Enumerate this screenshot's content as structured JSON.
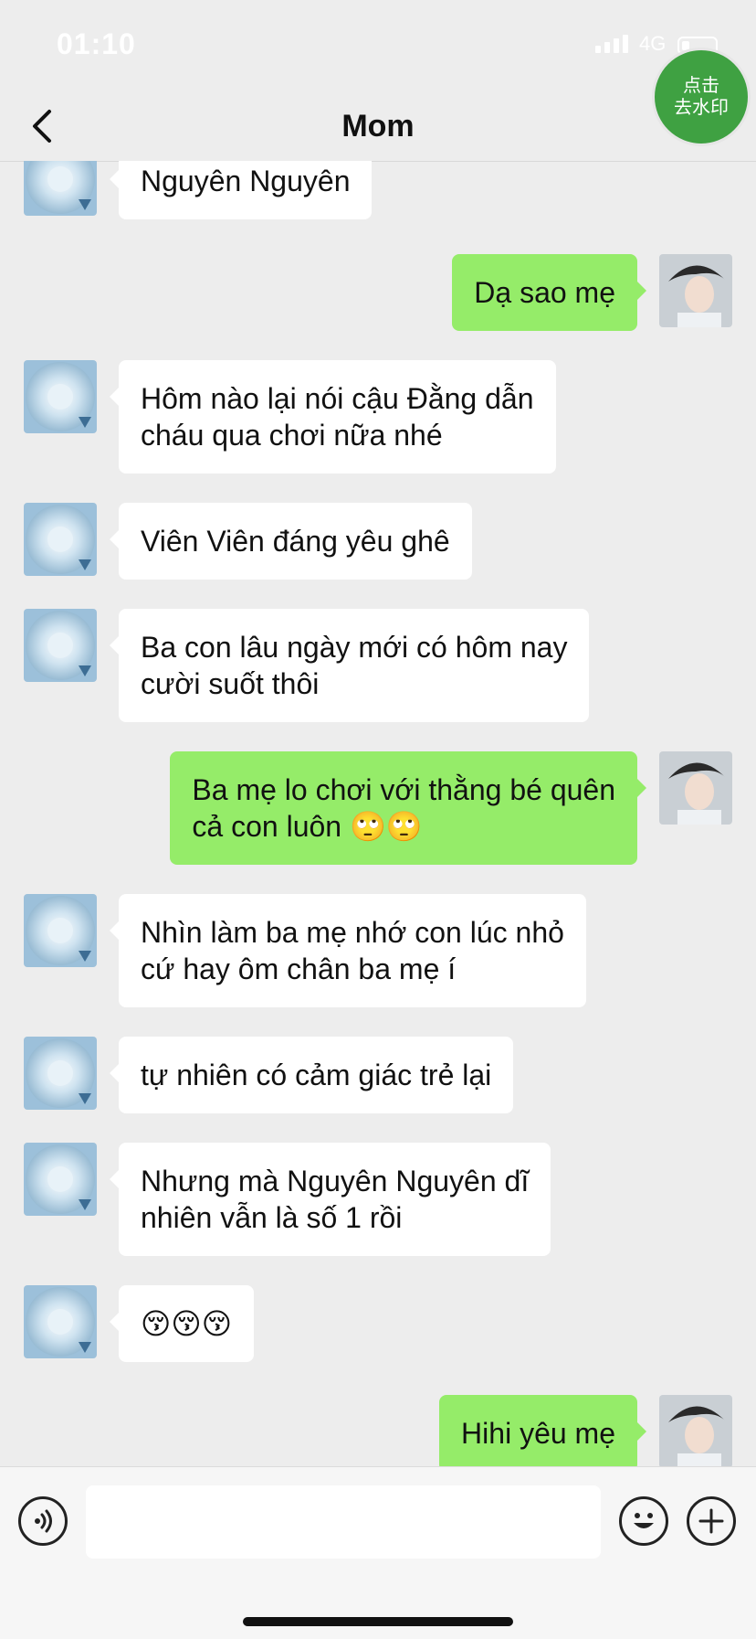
{
  "status_bar": {
    "time": "01:10",
    "network": "4G"
  },
  "header": {
    "title": "Mom"
  },
  "watermark_badge": {
    "line1": "点击",
    "line2": "去水印"
  },
  "messages": [
    {
      "from": "mom",
      "text": "Nguyên Nguyên"
    },
    {
      "from": "me",
      "text": "Dạ sao mẹ"
    },
    {
      "from": "mom",
      "text": "Hôm nào lại nói cậu Đằng dẫn\ncháu qua chơi nữa nhé"
    },
    {
      "from": "mom",
      "text": "Viên Viên đáng yêu ghê"
    },
    {
      "from": "mom",
      "text": "Ba con lâu ngày mới có hôm nay\ncười suốt thôi"
    },
    {
      "from": "me",
      "text": "Ba mẹ lo chơi với thằng bé quên\ncả con luôn 🙄🙄"
    },
    {
      "from": "mom",
      "text": "Nhìn làm ba mẹ nhớ con lúc nhỏ\ncứ hay ôm chân ba mẹ í"
    },
    {
      "from": "mom",
      "text": "tự nhiên có cảm giác trẻ lại"
    },
    {
      "from": "mom",
      "text": "Nhưng mà Nguyên Nguyên dĩ\nnhiên vẫn là số 1 rồi"
    },
    {
      "from": "mom",
      "text": "😚😚😚"
    },
    {
      "from": "me",
      "text": "Hihi yêu mẹ"
    }
  ],
  "input_bar": {
    "placeholder": ""
  },
  "colors": {
    "accent_green": "#95ec69",
    "badge_green": "#3fa142",
    "background": "#ededed"
  }
}
